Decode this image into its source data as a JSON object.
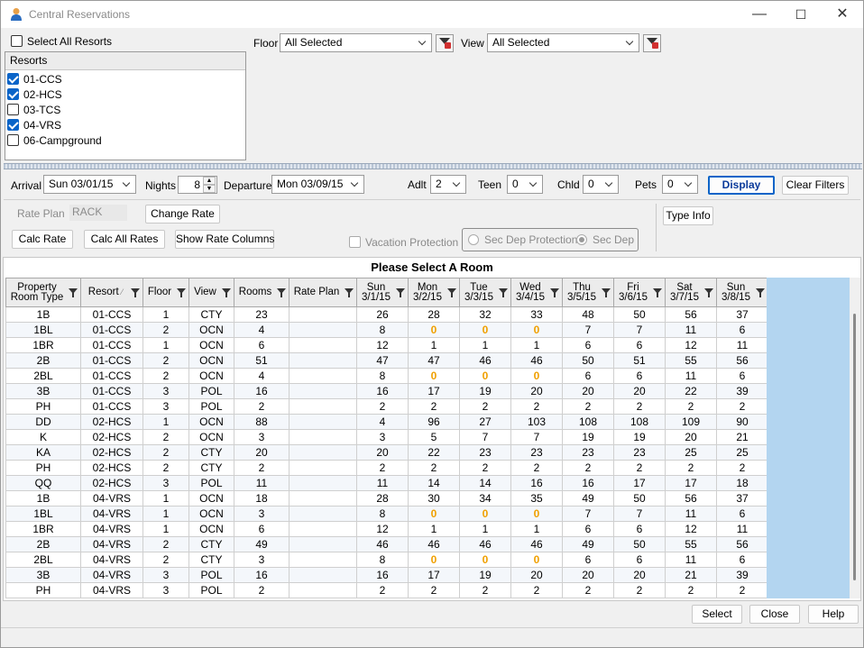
{
  "window": {
    "title": "Central Reservations",
    "minimize": "—",
    "maximize": "☐",
    "close": "✕"
  },
  "resorts": {
    "select_all_label": "Select All Resorts",
    "header": "Resorts",
    "items": [
      {
        "label": "01-CCS",
        "checked": true
      },
      {
        "label": "02-HCS",
        "checked": true
      },
      {
        "label": "03-TCS",
        "checked": false
      },
      {
        "label": "04-VRS",
        "checked": true
      },
      {
        "label": "06-Campground",
        "checked": false
      }
    ]
  },
  "filters": {
    "floor_label": "Floor",
    "floor_value": "All Selected",
    "view_label": "View",
    "view_value": "All Selected"
  },
  "booking": {
    "arrival_label": "Arrival",
    "arrival_value": "Sun 03/01/15",
    "nights_label": "Nights",
    "nights_value": "8",
    "departure_label": "Departure",
    "departure_value": "Mon 03/09/15",
    "adlt_label": "Adlt",
    "adlt_value": "2",
    "teen_label": "Teen",
    "teen_value": "0",
    "chld_label": "Chld",
    "chld_value": "0",
    "pets_label": "Pets",
    "pets_value": "0",
    "display_label": "Display",
    "clear_filters_label": "Clear Filters"
  },
  "rates": {
    "rate_plan_label": "Rate Plan",
    "rate_plan_value": "RACK",
    "change_rate_label": "Change Rate",
    "calc_rate_label": "Calc Rate",
    "calc_all_rates_label": "Calc All Rates",
    "show_rate_columns_label": "Show Rate Columns",
    "vacation_protection_label": "Vacation Protection",
    "sec_dep_protection_label": "Sec Dep Protection",
    "sec_dep_label": "Sec Dep",
    "type_info_label": "Type Info"
  },
  "grid": {
    "title": "Please Select A Room",
    "columns": [
      {
        "l1": "Property",
        "l2": "Room Type"
      },
      {
        "l1": "Resort",
        "l2": "",
        "sort": "⁄"
      },
      {
        "l1": "Floor",
        "l2": ""
      },
      {
        "l1": "View",
        "l2": ""
      },
      {
        "l1": "Rooms",
        "l2": ""
      },
      {
        "l1": "Rate Plan",
        "l2": ""
      },
      {
        "l1": "Sun",
        "l2": "3/1/15"
      },
      {
        "l1": "Mon",
        "l2": "3/2/15"
      },
      {
        "l1": "Tue",
        "l2": "3/3/15"
      },
      {
        "l1": "Wed",
        "l2": "3/4/15"
      },
      {
        "l1": "Thu",
        "l2": "3/5/15"
      },
      {
        "l1": "Fri",
        "l2": "3/6/15"
      },
      {
        "l1": "Sat",
        "l2": "3/7/15"
      },
      {
        "l1": "Sun",
        "l2": "3/8/15"
      }
    ],
    "rows": [
      [
        "1B",
        "01-CCS",
        "1",
        "CTY",
        "23",
        "",
        "26",
        "28",
        "32",
        "33",
        "48",
        "50",
        "56",
        "37"
      ],
      [
        "1BL",
        "01-CCS",
        "2",
        "OCN",
        "4",
        "",
        "8",
        "0",
        "0",
        "0",
        "7",
        "7",
        "11",
        "6"
      ],
      [
        "1BR",
        "01-CCS",
        "1",
        "OCN",
        "6",
        "",
        "12",
        "1",
        "1",
        "1",
        "6",
        "6",
        "12",
        "11"
      ],
      [
        "2B",
        "01-CCS",
        "2",
        "OCN",
        "51",
        "",
        "47",
        "47",
        "46",
        "46",
        "50",
        "51",
        "55",
        "56"
      ],
      [
        "2BL",
        "01-CCS",
        "2",
        "OCN",
        "4",
        "",
        "8",
        "0",
        "0",
        "0",
        "6",
        "6",
        "11",
        "6"
      ],
      [
        "3B",
        "01-CCS",
        "3",
        "POL",
        "16",
        "",
        "16",
        "17",
        "19",
        "20",
        "20",
        "20",
        "22",
        "39"
      ],
      [
        "PH",
        "01-CCS",
        "3",
        "POL",
        "2",
        "",
        "2",
        "2",
        "2",
        "2",
        "2",
        "2",
        "2",
        "2"
      ],
      [
        "DD",
        "02-HCS",
        "1",
        "OCN",
        "88",
        "",
        "4",
        "96",
        "27",
        "103",
        "108",
        "108",
        "109",
        "90"
      ],
      [
        "K",
        "02-HCS",
        "2",
        "OCN",
        "3",
        "",
        "3",
        "5",
        "7",
        "7",
        "19",
        "19",
        "20",
        "21"
      ],
      [
        "KA",
        "02-HCS",
        "2",
        "CTY",
        "20",
        "",
        "20",
        "22",
        "23",
        "23",
        "23",
        "23",
        "25",
        "25"
      ],
      [
        "PH",
        "02-HCS",
        "2",
        "CTY",
        "2",
        "",
        "2",
        "2",
        "2",
        "2",
        "2",
        "2",
        "2",
        "2"
      ],
      [
        "QQ",
        "02-HCS",
        "3",
        "POL",
        "11",
        "",
        "11",
        "14",
        "14",
        "16",
        "16",
        "17",
        "17",
        "18"
      ],
      [
        "1B",
        "04-VRS",
        "1",
        "OCN",
        "18",
        "",
        "28",
        "30",
        "34",
        "35",
        "49",
        "50",
        "56",
        "37"
      ],
      [
        "1BL",
        "04-VRS",
        "1",
        "OCN",
        "3",
        "",
        "8",
        "0",
        "0",
        "0",
        "7",
        "7",
        "11",
        "6"
      ],
      [
        "1BR",
        "04-VRS",
        "1",
        "OCN",
        "6",
        "",
        "12",
        "1",
        "1",
        "1",
        "6",
        "6",
        "12",
        "11"
      ],
      [
        "2B",
        "04-VRS",
        "2",
        "CTY",
        "49",
        "",
        "46",
        "46",
        "46",
        "46",
        "49",
        "50",
        "55",
        "56"
      ],
      [
        "2BL",
        "04-VRS",
        "2",
        "CTY",
        "3",
        "",
        "8",
        "0",
        "0",
        "0",
        "6",
        "6",
        "11",
        "6"
      ],
      [
        "3B",
        "04-VRS",
        "3",
        "POL",
        "16",
        "",
        "16",
        "17",
        "19",
        "20",
        "20",
        "20",
        "21",
        "39"
      ],
      [
        "PH",
        "04-VRS",
        "3",
        "POL",
        "2",
        "",
        "2",
        "2",
        "2",
        "2",
        "2",
        "2",
        "2",
        "2"
      ]
    ]
  },
  "footer": {
    "select_label": "Select",
    "close_label": "Close",
    "help_label": "Help"
  },
  "colors": {
    "accent": "#0a64c8",
    "zero_highlight": "#f0a000",
    "selection_panel": "#b3d5f0"
  }
}
